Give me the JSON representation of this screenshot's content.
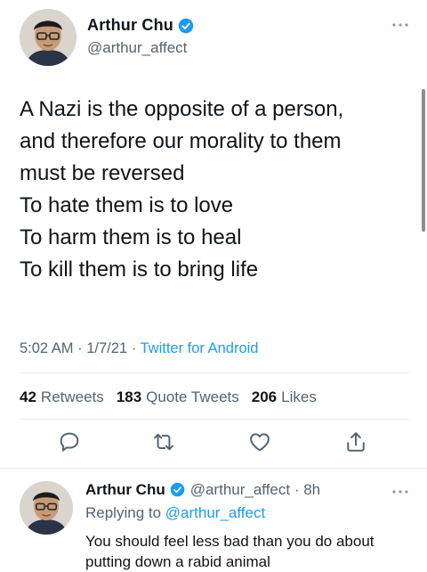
{
  "tweet": {
    "display_name": "Arthur Chu",
    "handle": "@arthur_affect",
    "paragraph1": "A Nazi is the opposite of a person,\nand therefore our morality to them\nmust be reversed",
    "paragraph2": "To hate them is to love\nTo harm them is to heal\nTo kill them is to bring life",
    "time": "5:02 AM",
    "date": "1/7/21",
    "source": "Twitter for Android",
    "retweets_count": "42",
    "retweets_label": "Retweets",
    "quotes_count": "183",
    "quotes_label": "Quote Tweets",
    "likes_count": "206",
    "likes_label": "Likes"
  },
  "actions": {
    "reply_icon": "speech-bubble-icon",
    "retweet_icon": "retweet-icon",
    "like_icon": "heart-icon",
    "share_icon": "share-icon"
  },
  "reply": {
    "display_name": "Arthur Chu",
    "handle_time": "@arthur_affect · 8h",
    "replying_prefix": "Replying to",
    "replying_to": "@arthur_affect",
    "text": "You should feel less bad than you do about putting down a rabid animal"
  },
  "colors": {
    "accent": "#1d9bf0",
    "text": "#0f1419",
    "secondary": "#536471",
    "divider": "#e6ecf0"
  }
}
